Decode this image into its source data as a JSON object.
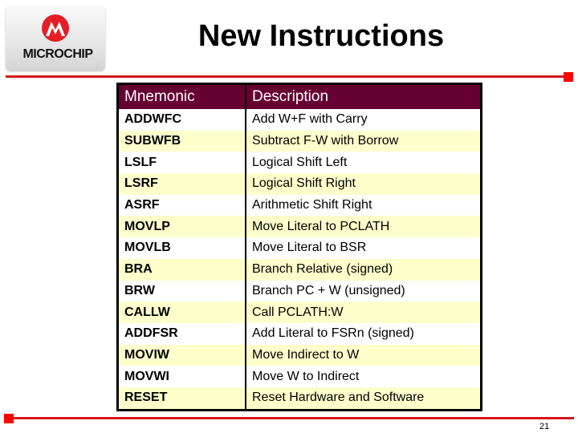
{
  "logo": {
    "name": "MICROCHIP",
    "icon": "microchip-logo-icon",
    "accent_color": "#e31e24"
  },
  "title": "New Instructions",
  "table": {
    "header_color": "#660033",
    "shade_color": "#ffffcc",
    "columns": [
      "Mnemonic",
      "Description"
    ],
    "rows": [
      {
        "mnemonic": "ADDWFC",
        "description": "Add W+F with Carry",
        "shaded": false
      },
      {
        "mnemonic": "SUBWFB",
        "description": "Subtract F-W with Borrow",
        "shaded": true
      },
      {
        "mnemonic": "LSLF",
        "description": "Logical Shift Left",
        "shaded": false
      },
      {
        "mnemonic": "LSRF",
        "description": "Logical Shift Right",
        "shaded": true
      },
      {
        "mnemonic": "ASRF",
        "description": "Arithmetic Shift Right",
        "shaded": false
      },
      {
        "mnemonic": "MOVLP",
        "description": "Move Literal to PCLATH",
        "shaded": true
      },
      {
        "mnemonic": "MOVLB",
        "description": "Move Literal to BSR",
        "shaded": false
      },
      {
        "mnemonic": "BRA",
        "description": "Branch Relative (signed)",
        "shaded": true
      },
      {
        "mnemonic": "BRW",
        "description": "Branch PC + W (unsigned)",
        "shaded": false
      },
      {
        "mnemonic": "CALLW",
        "description": "Call PCLATH:W",
        "shaded": true
      },
      {
        "mnemonic": "ADDFSR",
        "description": "Add Literal to FSRn (signed)",
        "shaded": false
      },
      {
        "mnemonic": "MOVIW",
        "description": "Move Indirect to W",
        "shaded": true
      },
      {
        "mnemonic": "MOVWI",
        "description": "Move W to Indirect",
        "shaded": false
      },
      {
        "mnemonic": "RESET",
        "description": "Reset Hardware and Software",
        "shaded": true
      }
    ]
  },
  "page_number": "21"
}
